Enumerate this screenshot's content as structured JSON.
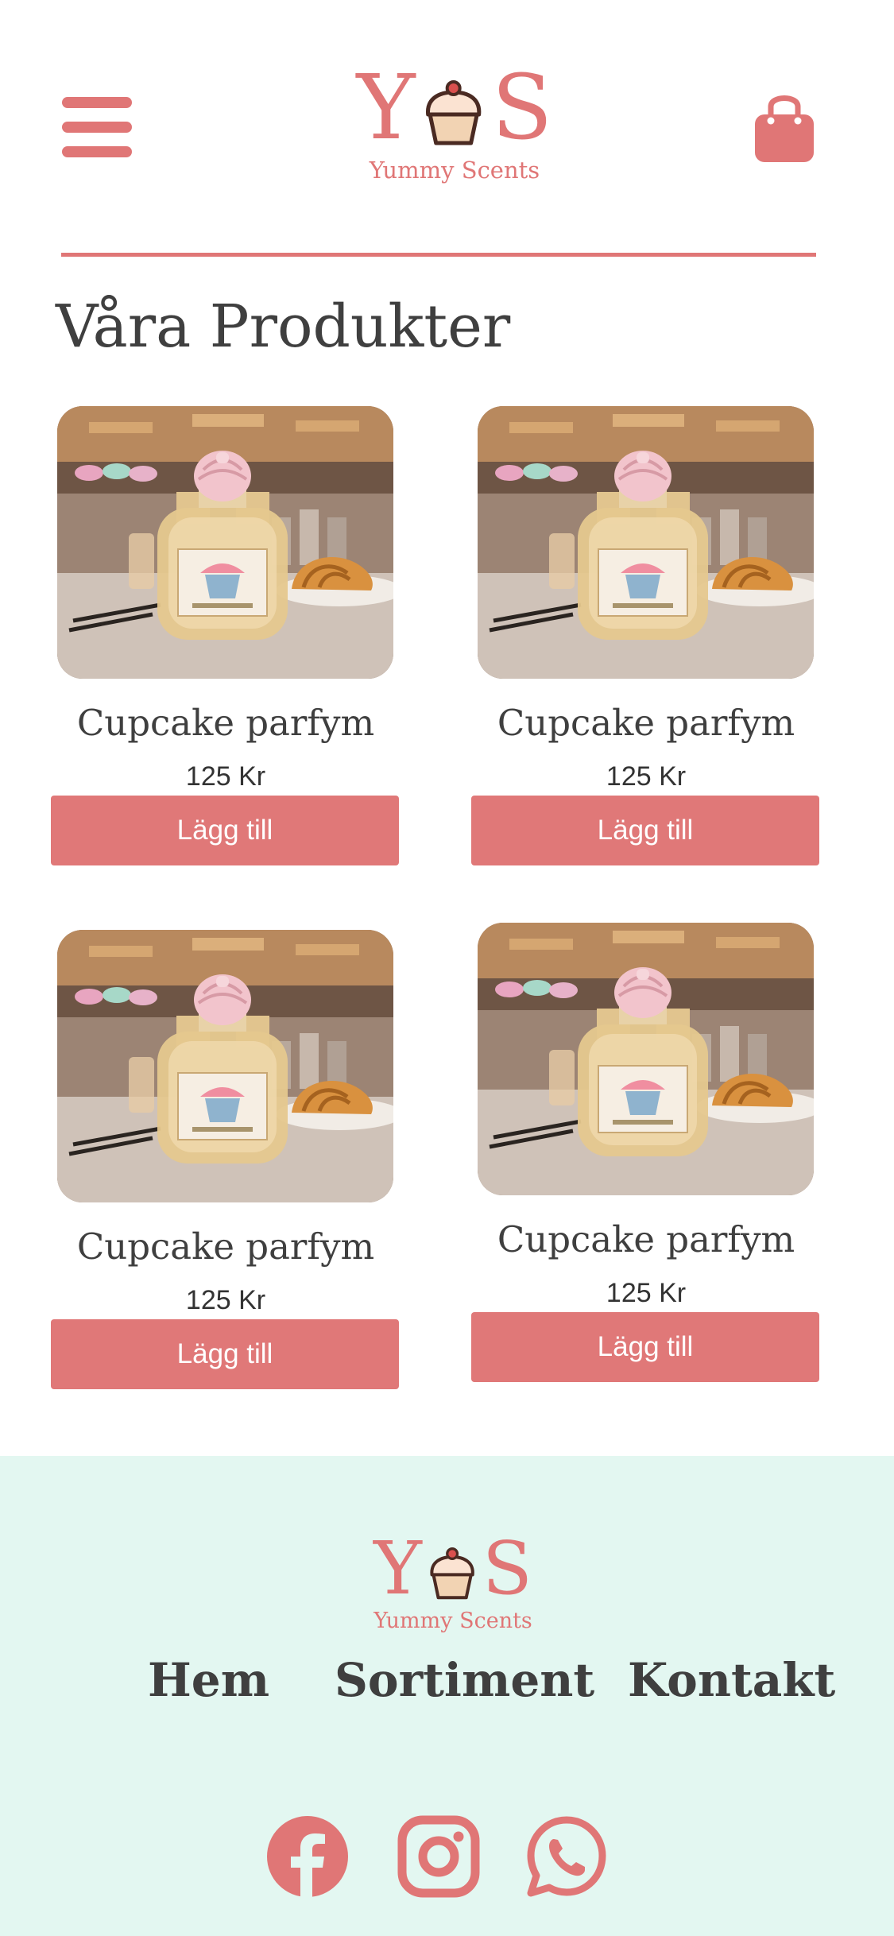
{
  "brand": {
    "logo_left": "Y",
    "logo_right": "S",
    "tagline": "Yummy Scents",
    "accent_color": "#E07676"
  },
  "header": {
    "menu_icon": "hamburger-menu-icon",
    "cart_icon": "shopping-bag-icon"
  },
  "main": {
    "title": "Våra Produkter",
    "products": [
      {
        "name": "Cupcake parfym",
        "price": "125 Kr",
        "button": "Lägg till"
      },
      {
        "name": "Cupcake parfym",
        "price": "125 Kr",
        "button": "Lägg till"
      },
      {
        "name": "Cupcake parfym",
        "price": "125 Kr",
        "button": "Lägg till"
      },
      {
        "name": "Cupcake parfym",
        "price": "125 Kr",
        "button": "Lägg till"
      }
    ]
  },
  "footer": {
    "background": "#E3F7F1",
    "nav": [
      {
        "label": "Hem"
      },
      {
        "label": "Sortiment"
      },
      {
        "label": "Kontakt"
      }
    ],
    "social_icons": [
      "facebook-icon",
      "instagram-icon",
      "whatsapp-icon"
    ]
  }
}
